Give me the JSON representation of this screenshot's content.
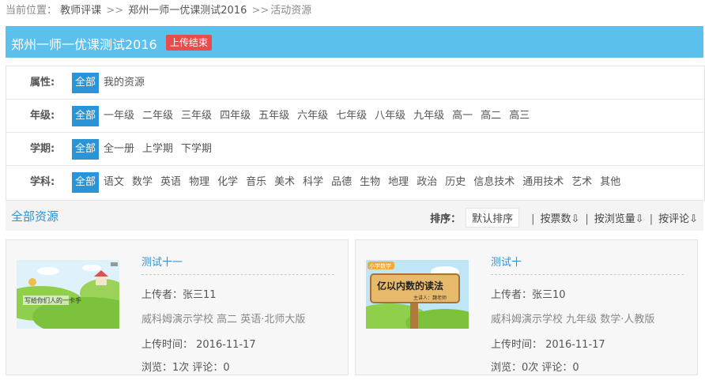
{
  "breadcrumb": {
    "label": "当前位置：",
    "items": [
      "教师评课",
      "郑州一师一优课测试2016",
      "活动资源"
    ],
    "sep": ">>"
  },
  "activity": {
    "title": "郑州一师一优课测试2016",
    "status": "上传结束"
  },
  "filters": [
    {
      "label": "属性:",
      "options": [
        "全部",
        "我的资源"
      ]
    },
    {
      "label": "年级:",
      "options": [
        "全部",
        "一年级",
        "二年级",
        "三年级",
        "四年级",
        "五年级",
        "六年级",
        "七年级",
        "八年级",
        "九年级",
        "高一",
        "高二",
        "高三"
      ]
    },
    {
      "label": "学期:",
      "options": [
        "全部",
        "全一册",
        "上学期",
        "下学期"
      ]
    },
    {
      "label": "学科:",
      "options": [
        "全部",
        "语文",
        "数学",
        "英语",
        "物理",
        "化学",
        "音乐",
        "美术",
        "科学",
        "品德",
        "生物",
        "地理",
        "政治",
        "历史",
        "信息技术",
        "通用技术",
        "艺术",
        "其他"
      ]
    }
  ],
  "list": {
    "all_label": "全部资源",
    "sort_label": "排序：",
    "sort_default": "默认排序",
    "sort_votes": "按票数⇩",
    "sort_views": "按浏览量⇩",
    "sort_comments": "按评论⇩",
    "sep": "|"
  },
  "resources": [
    {
      "title": "测试十一",
      "uploader": "上传者：张三11",
      "school": "威科姆演示学校 高二 英语·北师大版",
      "time": "上传时间：  2016-11-17",
      "stats": "浏览：1次 评论：0",
      "thumb_text": "写给你们人的一卡手"
    },
    {
      "title": "测试十",
      "uploader": "上传者：张三10",
      "school": "威科姆演示学校 九年级 数学·人教版",
      "time": "上传时间：  2016-11-17",
      "stats": "浏览：0次 评论：0",
      "thumb_text": "亿以内数的读法",
      "thumb_sub": "主讲人：魏老师",
      "thumb_logo": "小学数学"
    }
  ]
}
